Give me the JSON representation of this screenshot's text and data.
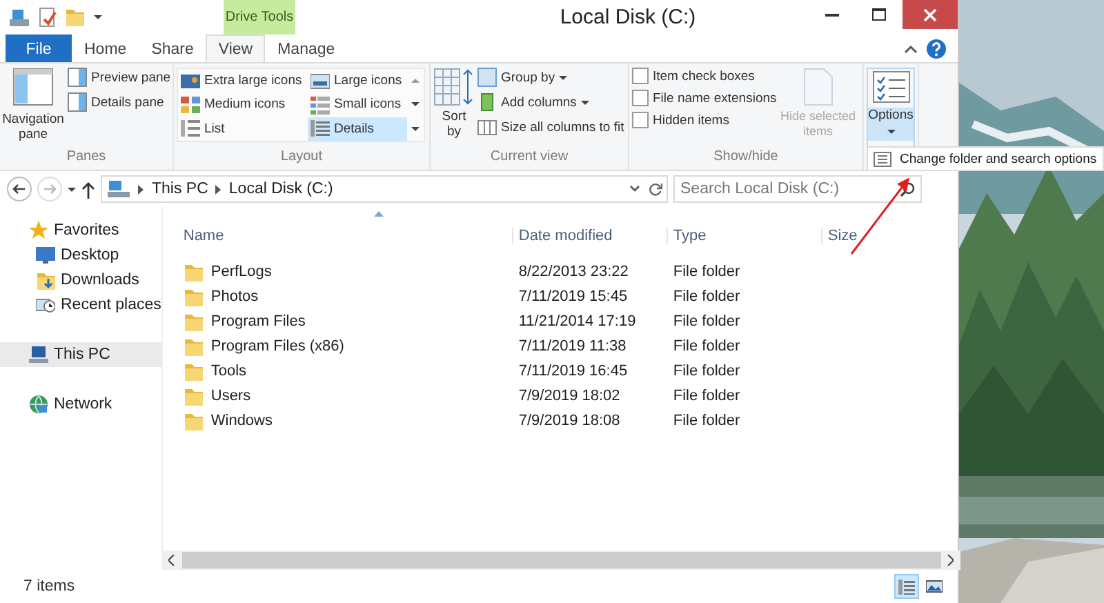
{
  "window": {
    "title": "Local Disk (C:)"
  },
  "contextual_tab": {
    "label": "Drive Tools"
  },
  "tabs": [
    {
      "label": "File",
      "kind": "file",
      "selected": false
    },
    {
      "label": "Home",
      "kind": "tab",
      "selected": false
    },
    {
      "label": "Share",
      "kind": "tab",
      "selected": false
    },
    {
      "label": "View",
      "kind": "tab",
      "selected": true
    },
    {
      "label": "Manage",
      "kind": "tab",
      "selected": false
    }
  ],
  "ribbon": {
    "panes": {
      "label": "Panes",
      "navigation": "Navigation pane",
      "items": [
        "Preview pane",
        "Details pane"
      ]
    },
    "layout": {
      "label": "Layout",
      "items": [
        {
          "label": "Extra large icons",
          "selected": false
        },
        {
          "label": "Large icons",
          "selected": false
        },
        {
          "label": "Medium icons",
          "selected": false
        },
        {
          "label": "Small icons",
          "selected": false
        },
        {
          "label": "List",
          "selected": false
        },
        {
          "label": "Details",
          "selected": true
        }
      ]
    },
    "current_view": {
      "label": "Current view",
      "sort": "Sort by",
      "items": [
        {
          "label": "Group by",
          "dropdown": true
        },
        {
          "label": "Add columns",
          "dropdown": true
        },
        {
          "label": "Size all columns to fit",
          "dropdown": false
        }
      ]
    },
    "show_hide": {
      "label": "Show/hide",
      "checkboxes": [
        {
          "label": "Item check boxes",
          "checked": false
        },
        {
          "label": "File name extensions",
          "checked": false
        },
        {
          "label": "Hidden items",
          "checked": false
        }
      ],
      "hide_selected": {
        "label": "Hide selected items",
        "disabled": true
      }
    },
    "options": {
      "label": "Options"
    }
  },
  "tooltip": "Change folder and search options",
  "address": {
    "path": [
      "This PC",
      "Local Disk (C:)"
    ],
    "search_placeholder": "Search Local Disk (C:)"
  },
  "navigation": [
    {
      "label": "Favorites",
      "kind": "favorites",
      "selected": false,
      "children": [
        {
          "label": "Desktop",
          "kind": "desktop",
          "selected": false
        },
        {
          "label": "Downloads",
          "kind": "downloads",
          "selected": false
        },
        {
          "label": "Recent places",
          "kind": "recent",
          "selected": false
        }
      ]
    },
    {
      "label": "This PC",
      "kind": "pc",
      "selected": true
    },
    {
      "label": "Network",
      "kind": "network",
      "selected": false
    }
  ],
  "table": {
    "columns": [
      "Name",
      "Date modified",
      "Type",
      "Size"
    ],
    "rows": [
      {
        "name": "PerfLogs",
        "date": "8/22/2013 23:22",
        "type": "File folder"
      },
      {
        "name": "Photos",
        "date": "7/11/2019 15:45",
        "type": "File folder"
      },
      {
        "name": "Program Files",
        "date": "11/21/2014 17:19",
        "type": "File folder"
      },
      {
        "name": "Program Files (x86)",
        "date": "7/11/2019 11:38",
        "type": "File folder"
      },
      {
        "name": "Tools",
        "date": "7/11/2019 16:45",
        "type": "File folder"
      },
      {
        "name": "Users",
        "date": "7/9/2019 18:02",
        "type": "File folder"
      },
      {
        "name": "Windows",
        "date": "7/9/2019 18:08",
        "type": "File folder"
      }
    ]
  },
  "status_bar": {
    "count": "7 items",
    "views": [
      {
        "kind": "details",
        "selected": true
      },
      {
        "kind": "large",
        "selected": false
      }
    ]
  }
}
